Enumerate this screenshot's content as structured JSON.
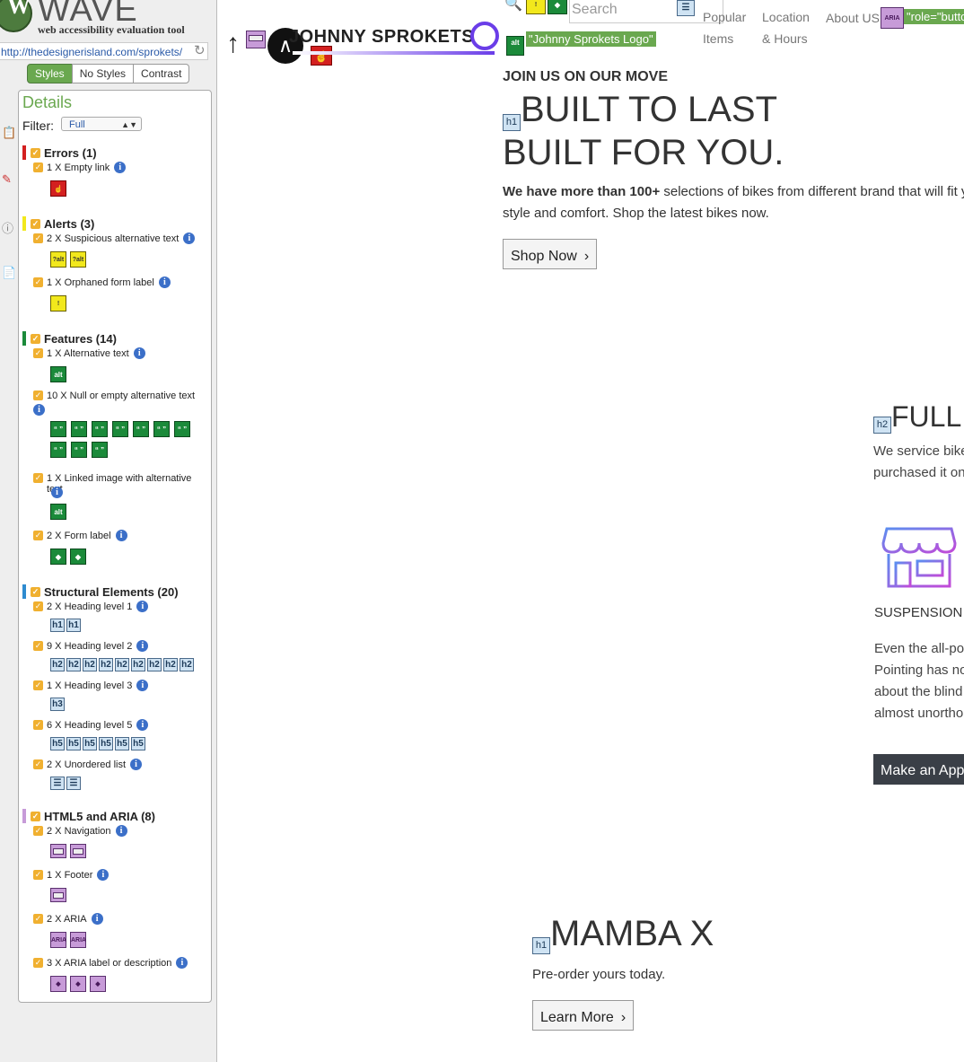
{
  "wave": {
    "logo_letter": "W",
    "logo_word": "WAVE",
    "tagline": "web accessibility evaluation tool",
    "url": "http://thedesignerisland.com/sprokets/",
    "tabs": [
      "Styles",
      "No Styles",
      "Contrast"
    ],
    "details_title": "Details",
    "filter_label": "Filter:",
    "filter_value": "Full",
    "categories": {
      "errors": {
        "title": "Errors (1)",
        "color": "#d32020"
      },
      "alerts": {
        "title": "Alerts (3)",
        "color": "#f2e81c"
      },
      "features": {
        "title": "Features (14)",
        "color": "#1b8a3a"
      },
      "structural": {
        "title": "Structural Elements (20)",
        "color": "#2e8bd0"
      },
      "aria": {
        "title": "HTML5 and ARIA (8)",
        "color": "#c79bd8"
      }
    },
    "items": {
      "empty_link": "1 X Empty link",
      "suspicious_alt": "2 X Suspicious alternative text",
      "orphaned_label": "1 X Orphaned form label",
      "alt_text": "1 X Alternative text",
      "null_alt": "10 X Null or empty alternative text",
      "linked_image": "1 X Linked image with alternative text",
      "form_label": "2 X Form label",
      "h1": "2 X Heading level 1",
      "h2": "9 X Heading level 2",
      "h3": "1 X Heading level 3",
      "h5": "6 X Heading level 5",
      "ul": "2 X Unordered list",
      "nav": "2 X Navigation",
      "footer": "1 X Footer",
      "aria": "2 X ARIA",
      "aria_label": "3 X ARIA label or description"
    },
    "icon_text": {
      "alt": "alt",
      "h1": "h1",
      "h2": "h2",
      "h3": "h3",
      "h5": "h5",
      "aria": "ARIA",
      "quote": "“ ”"
    }
  },
  "site": {
    "brand": "JOHNNY SPROKETS",
    "logo_label": "\"Johnny Sprokets Logo\"",
    "search_placeholder": "Search",
    "nav": [
      "Popular Items",
      "Location & Hours",
      "About US"
    ],
    "role_tag": "\"role=\"butto",
    "aria_badge": "ARIA",
    "hero": {
      "eyebrow": "JOIN US ON OUR MOVE",
      "title_line1": "BUILT TO LAST",
      "title_line2": "BUILT FOR YOU.",
      "desc_bold": "We have more than 100+",
      "desc_rest": " selections of bikes from different brand that will fit your",
      "desc_line2": "style and comfort. Shop the latest bikes now.",
      "cta": "Shop Now"
    },
    "service": {
      "title": "FULL",
      "text_line1": "We service bikes",
      "text_line2": "purchased it on",
      "feature_label": "SUSPENSION",
      "feature_lines": [
        "Even the all-po",
        "Pointing has no",
        "about the blind",
        "almost unortho"
      ],
      "cta": "Make an Appo"
    },
    "mamba": {
      "title": "MAMBA X",
      "subtitle": "Pre-order yours today.",
      "cta": "Learn More"
    }
  }
}
